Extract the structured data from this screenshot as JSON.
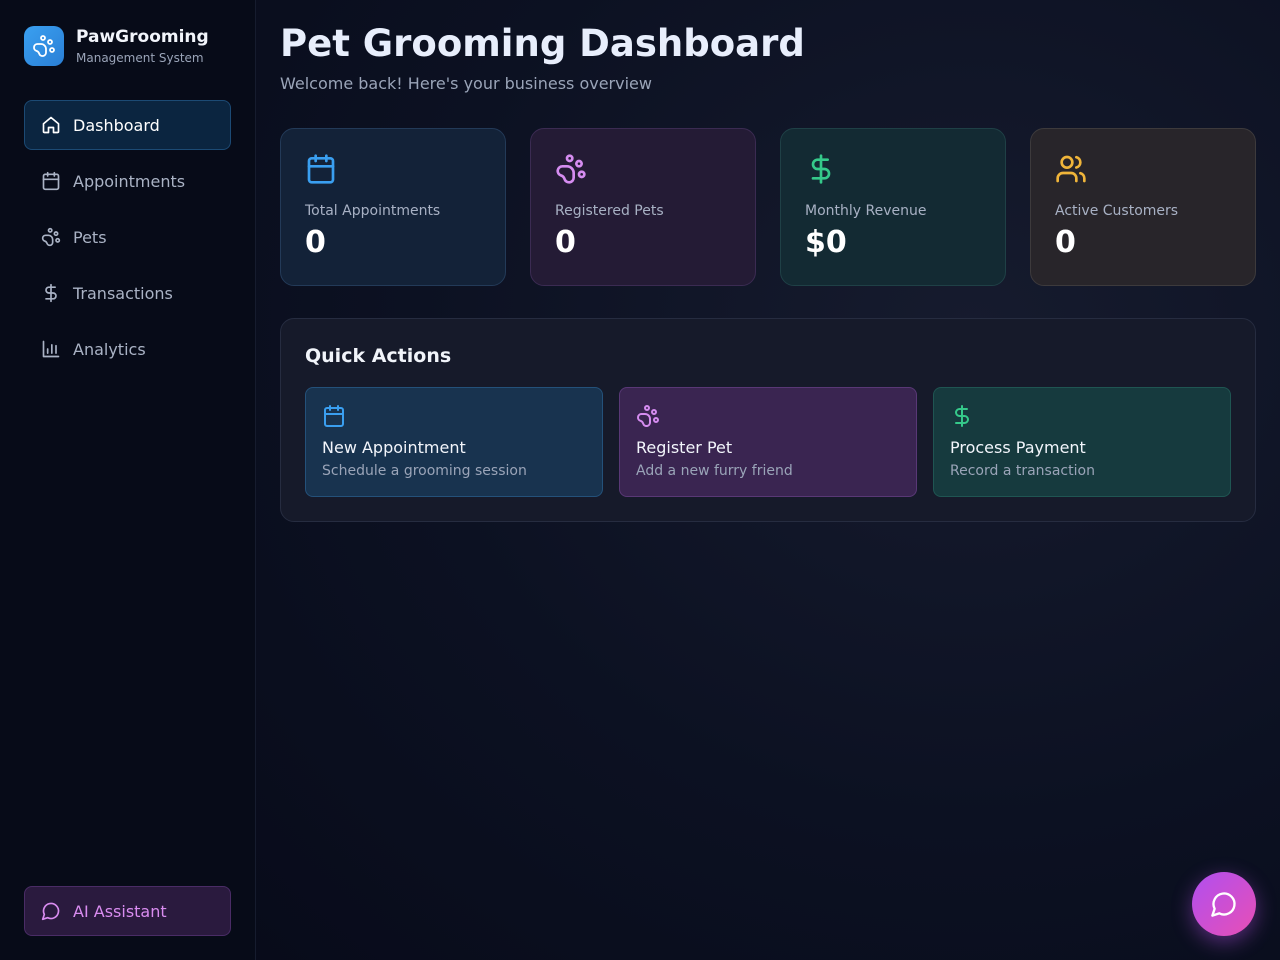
{
  "brand": {
    "title": "PawGrooming",
    "subtitle": "Management System"
  },
  "sidebar": {
    "items": [
      {
        "label": "Dashboard",
        "icon": "home-icon",
        "active": true
      },
      {
        "label": "Appointments",
        "icon": "calendar-icon",
        "active": false
      },
      {
        "label": "Pets",
        "icon": "paw-icon",
        "active": false
      },
      {
        "label": "Transactions",
        "icon": "dollar-icon",
        "active": false
      },
      {
        "label": "Analytics",
        "icon": "bar-chart-icon",
        "active": false
      }
    ],
    "ai_assistant_label": "AI Assistant"
  },
  "header": {
    "title": "Pet Grooming Dashboard",
    "subtitle": "Welcome back! Here's your business overview"
  },
  "stats": [
    {
      "label": "Total Appointments",
      "value": "0",
      "icon": "calendar-icon",
      "color": "#3a9ff0"
    },
    {
      "label": "Registered Pets",
      "value": "0",
      "icon": "paw-icon",
      "color": "#d58cf0"
    },
    {
      "label": "Monthly Revenue",
      "value": "$0",
      "icon": "dollar-icon",
      "color": "#35c98a"
    },
    {
      "label": "Active Customers",
      "value": "0",
      "icon": "users-icon",
      "color": "#f0b53a"
    }
  ],
  "quick_actions": {
    "title": "Quick Actions",
    "items": [
      {
        "label": "New Appointment",
        "sub": "Schedule a grooming session",
        "icon": "calendar-icon",
        "color": "#3a9ff0"
      },
      {
        "label": "Register Pet",
        "sub": "Add a new furry friend",
        "icon": "paw-icon",
        "color": "#d58cf0"
      },
      {
        "label": "Process Payment",
        "sub": "Record a transaction",
        "icon": "dollar-icon",
        "color": "#35c98a"
      }
    ]
  },
  "fab": {
    "icon": "chat-bubble-icon"
  }
}
